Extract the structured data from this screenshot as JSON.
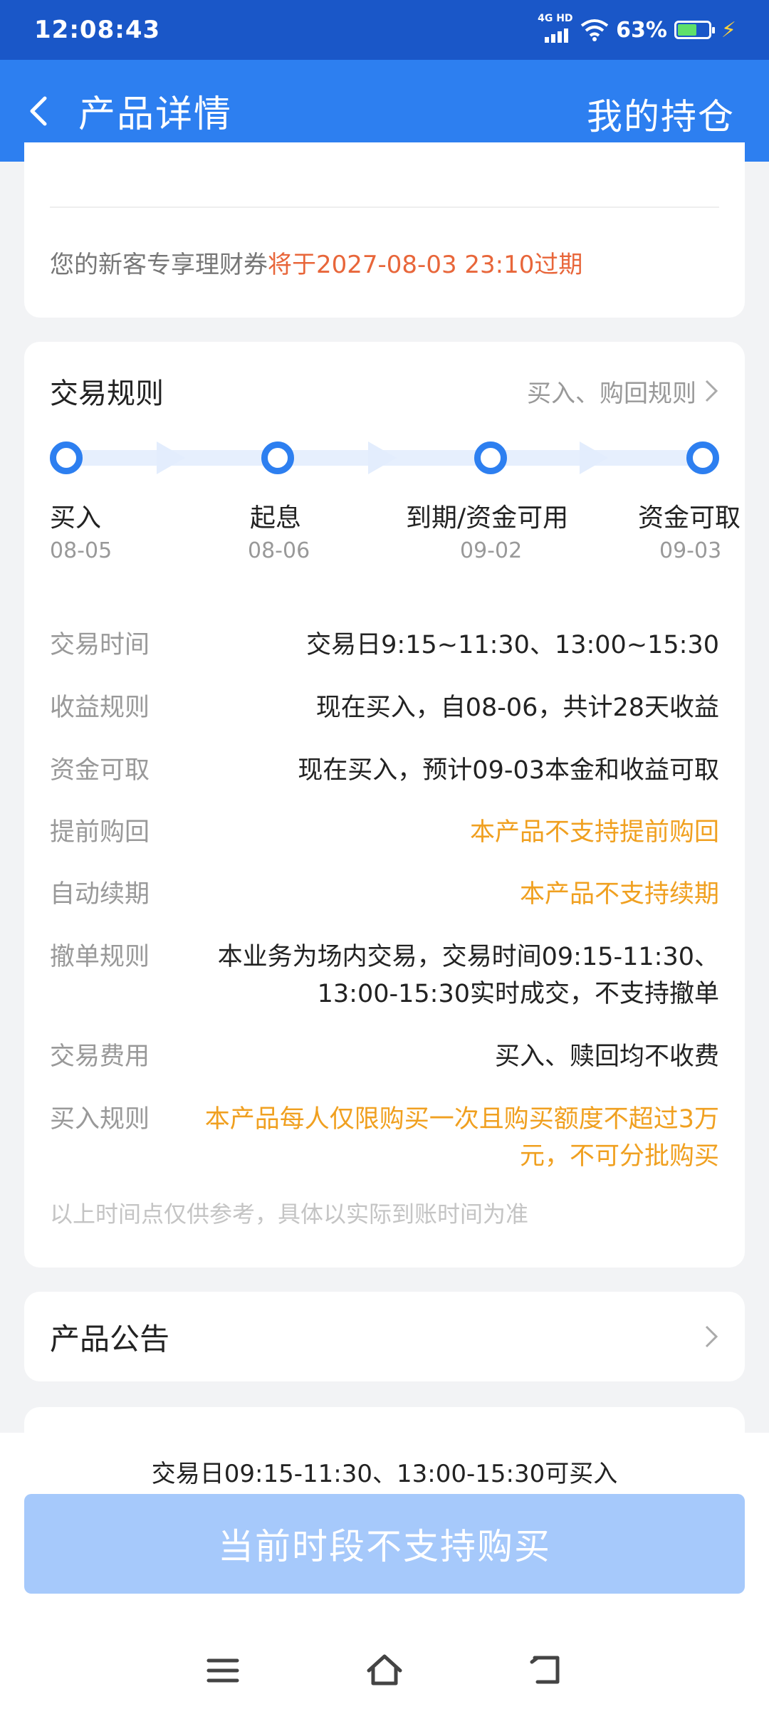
{
  "status_bar": {
    "time": "12:08:43",
    "network": "4G HD",
    "battery_percent": "63%",
    "battery_level": 0.63
  },
  "nav": {
    "title": "产品详情",
    "right_action": "我的持仓"
  },
  "coupon": {
    "prefix": "您的新客专享理财券",
    "highlight": "将于2027-08-03 23:10过期"
  },
  "rules": {
    "title": "交易规则",
    "link": "买入、购回规则",
    "timeline": [
      {
        "label": "买入",
        "date": "08-05"
      },
      {
        "label": "起息",
        "date": "08-06"
      },
      {
        "label": "到期/资金可用",
        "date": "09-02"
      },
      {
        "label": "资金可取",
        "date": "09-03"
      }
    ],
    "items": [
      {
        "key": "交易时间",
        "value": "交易日9:15~11:30、13:00~15:30"
      },
      {
        "key": "收益规则",
        "value": "现在买入，自08-06，共计28天收益"
      },
      {
        "key": "资金可取",
        "value": "现在买入，预计09-03本金和收益可取"
      },
      {
        "key": "提前购回",
        "value": "本产品不支持提前购回"
      },
      {
        "key": "自动续期",
        "value": "本产品不支持续期"
      },
      {
        "key": "撤单规则",
        "value": "本业务为场内交易，交易时间09:15-11:30、13:00-15:30实时成交，不支持撤单"
      },
      {
        "key": "交易费用",
        "value": "买入、赎回均不收费"
      },
      {
        "key": "买入规则",
        "value": "本产品每人仅限购买一次且购买额度不超过3万元，不可分批购买"
      }
    ],
    "footnote": "以上时间点仅供参考，具体以实际到账时间为准"
  },
  "announcement": {
    "title": "产品公告"
  },
  "bottom": {
    "hint": "交易日09:15-11:30、13:00-15:30可买入",
    "buy_button": "当前时段不支持购买"
  },
  "colors": {
    "status_bar": "#1a57c8",
    "nav_bar": "#2d7ff0",
    "highlight_red": "#e8663a",
    "highlight_orange": "#f0a020",
    "button_disabled": "#a6c9fb"
  }
}
